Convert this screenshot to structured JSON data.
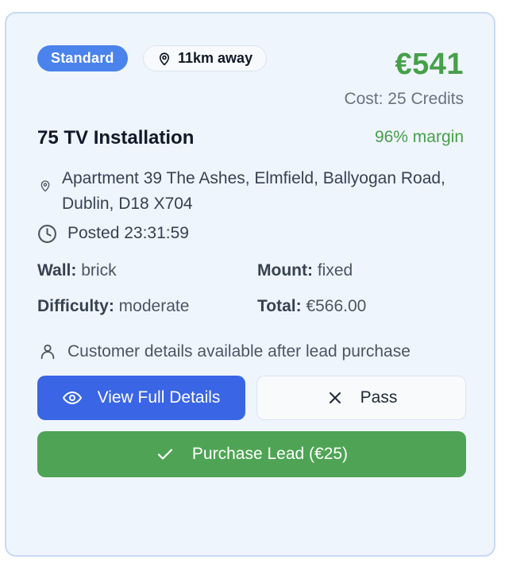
{
  "lead": {
    "type_badge": "Standard",
    "distance": "11km away",
    "price": "€541",
    "cost": "Cost: 25 Credits",
    "title": "75 TV Installation",
    "margin": "96% margin",
    "address": "Apartment 39 The Ashes, Elmfield, Ballyogan Road, Dublin, D18 X704",
    "posted": "Posted 23:31:59",
    "specs": {
      "wall_label": "Wall:",
      "wall_value": "brick",
      "mount_label": "Mount:",
      "mount_value": "fixed",
      "difficulty_label": "Difficulty:",
      "difficulty_value": "moderate",
      "total_label": "Total:",
      "total_value": "€566.00"
    },
    "customer_note": "Customer details available after lead purchase"
  },
  "actions": {
    "view_label": "View Full Details",
    "pass_label": "Pass",
    "purchase_label": "Purchase Lead (€25)"
  },
  "colors": {
    "accent_blue": "#3a65e4",
    "badge_blue": "#4a83ec",
    "success_green": "#46a049",
    "card_bg": "#eff5fd"
  },
  "icons": [
    "map-pin-icon",
    "clock-icon",
    "user-icon",
    "eye-icon",
    "close-icon",
    "check-icon"
  ]
}
